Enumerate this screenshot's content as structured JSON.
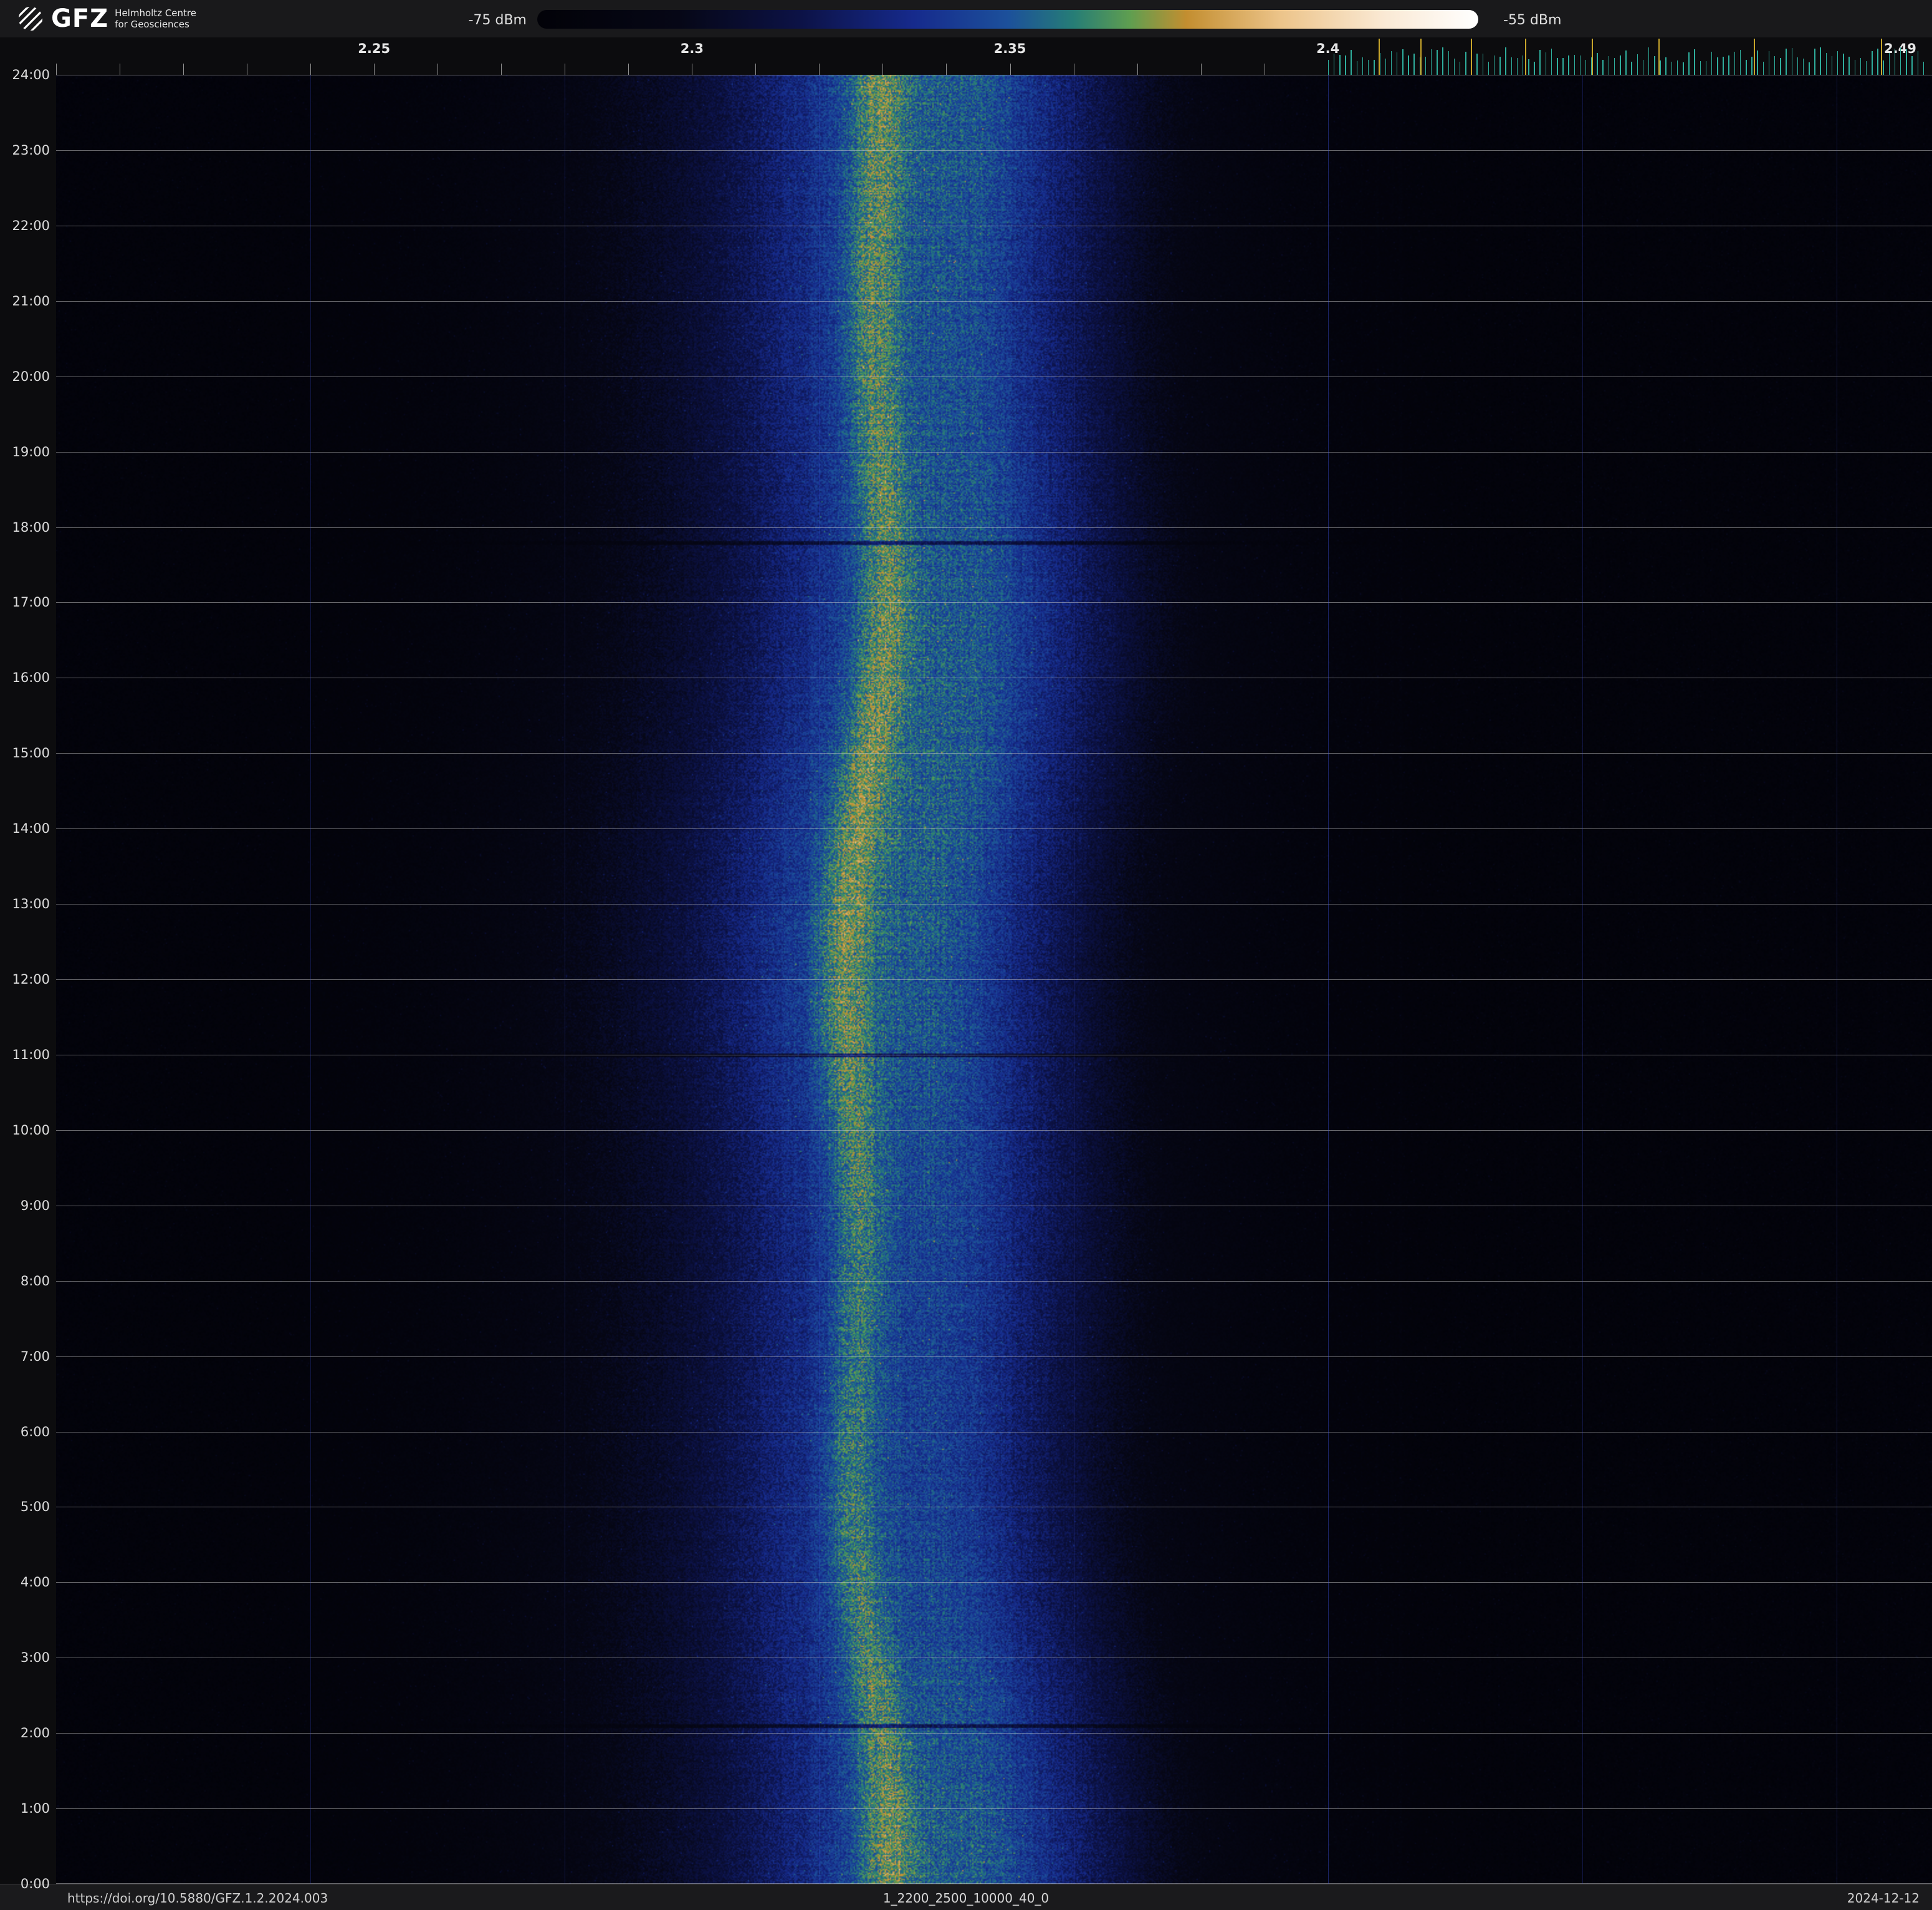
{
  "header": {
    "logo_text": "GFZ",
    "logo_subtitle_line1": "Helmholtz Centre",
    "logo_subtitle_line2": "for Geosciences"
  },
  "colorbar": {
    "min_label": "-75 dBm",
    "max_label": "-55 dBm",
    "stops": [
      {
        "pos": 0.0,
        "color": "#020208"
      },
      {
        "pos": 0.15,
        "color": "#060716"
      },
      {
        "pos": 0.28,
        "color": "#0c1246"
      },
      {
        "pos": 0.4,
        "color": "#162a8c"
      },
      {
        "pos": 0.5,
        "color": "#1c509b"
      },
      {
        "pos": 0.57,
        "color": "#267d76"
      },
      {
        "pos": 0.63,
        "color": "#5f9e50"
      },
      {
        "pos": 0.69,
        "color": "#c38e30"
      },
      {
        "pos": 0.79,
        "color": "#ecc48a"
      },
      {
        "pos": 0.9,
        "color": "#fae9d4"
      },
      {
        "pos": 1.0,
        "color": "#ffffff"
      }
    ]
  },
  "footer": {
    "doi": "https://doi.org/10.5880/GFZ.1.2.2024.003",
    "dataset": "1_2200_2500_10000_40_0",
    "date": "2024-12-12"
  },
  "top_ticks": {
    "minor_step_ghz": 0.01,
    "minor_range": [
      2.2,
      2.4
    ],
    "minor_color": "#8f8f8f",
    "dense_range": [
      2.4,
      2.494
    ],
    "dense_step_ghz": 0.0009,
    "dense_color": "#2fae9d",
    "tall_tick_values": [
      2.408,
      2.4145,
      2.4225,
      2.431,
      2.4415,
      2.452,
      2.467,
      2.487
    ],
    "tall_color": "#c8a62b"
  },
  "chart_data": {
    "type": "heatmap",
    "title": "",
    "x_unit": "GHz",
    "x_range": [
      2.2,
      2.495
    ],
    "x_ticks": [
      {
        "value": 2.25,
        "label": "2.25"
      },
      {
        "value": 2.3,
        "label": "2.3"
      },
      {
        "value": 2.35,
        "label": "2.35"
      },
      {
        "value": 2.4,
        "label": "2.4"
      },
      {
        "value": 2.49,
        "label": "2.49"
      }
    ],
    "y_ticks": [
      "24:00",
      "23:00",
      "22:00",
      "21:00",
      "20:00",
      "19:00",
      "18:00",
      "17:00",
      "16:00",
      "15:00",
      "14:00",
      "13:00",
      "12:00",
      "11:00",
      "10:00",
      "9:00",
      "8:00",
      "7:00",
      "6:00",
      "5:00",
      "4:00",
      "3:00",
      "2:00",
      "1:00",
      "0:00"
    ],
    "value_range": {
      "min_dbm": -75,
      "max_dbm": -55
    },
    "signal_band": {
      "center_ghz": 2.3265,
      "core_width_ghz": 0.006,
      "mid_width_ghz": 0.028,
      "outer_width_ghz": 0.064,
      "secondary_peaks_ghz": [
        2.3455,
        2.3605
      ],
      "peak_level_dbm": -62,
      "background_level_dbm": -75
    },
    "artifact_lines_time_fraction": [
      0.2585,
      0.5417,
      0.9125
    ],
    "gridlines": {
      "hours_step": 1,
      "freq_step_ghz": 0.04
    }
  }
}
